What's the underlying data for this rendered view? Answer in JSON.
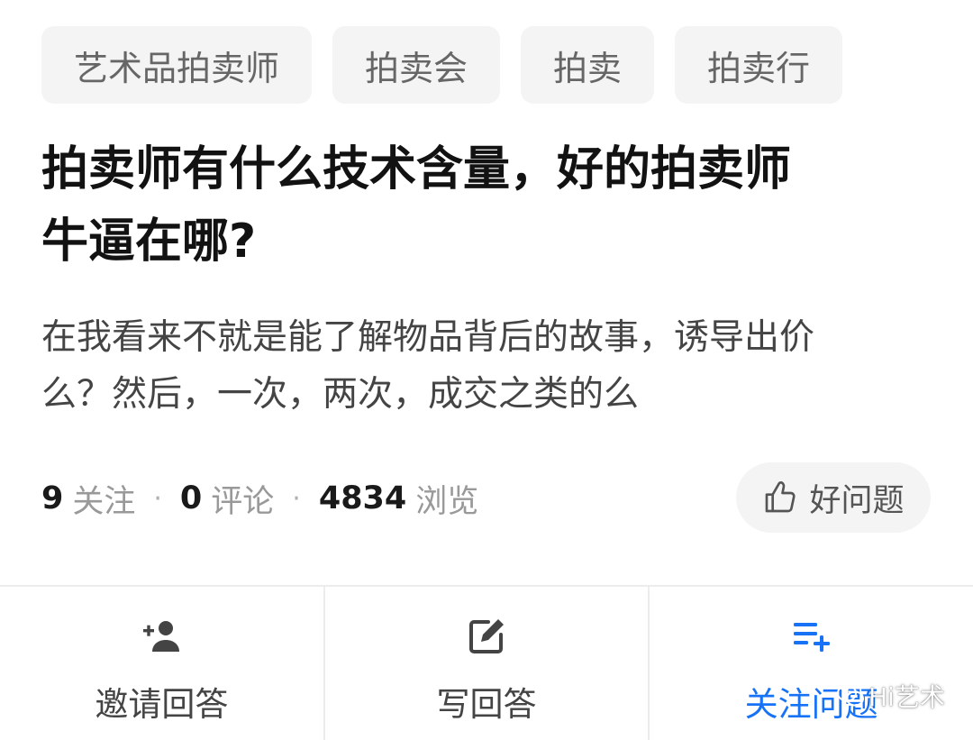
{
  "tags": [
    "艺术品拍卖师",
    "拍卖会",
    "拍卖",
    "拍卖行"
  ],
  "question": {
    "title_line1": "拍卖师有什么技术含量，好的拍卖师",
    "title_line2": "牛逼在哪?",
    "desc_line1": "在我看来不就是能了解物品背后的故事，诱导出价",
    "desc_line2": "么？然后，一次，两次，成交之类的么"
  },
  "stats": {
    "followers_count": "9",
    "followers_label": "关注",
    "comments_count": "0",
    "comments_label": "评论",
    "views_count": "4834",
    "views_label": "浏览",
    "separator": "·"
  },
  "good_question": {
    "label": "好问题",
    "icon": "thumbs-up-icon"
  },
  "actions": [
    {
      "label": "邀请回答",
      "icon": "add-user-icon"
    },
    {
      "label": "写回答",
      "icon": "edit-icon"
    },
    {
      "label": "关注问题",
      "icon": "add-list-icon"
    }
  ],
  "watermark": {
    "text": "Hi艺术",
    "icon": "wechat-icon"
  },
  "colors": {
    "accent": "#1772f6",
    "tag_bg": "#f4f4f4",
    "muted_text": "#999999"
  }
}
